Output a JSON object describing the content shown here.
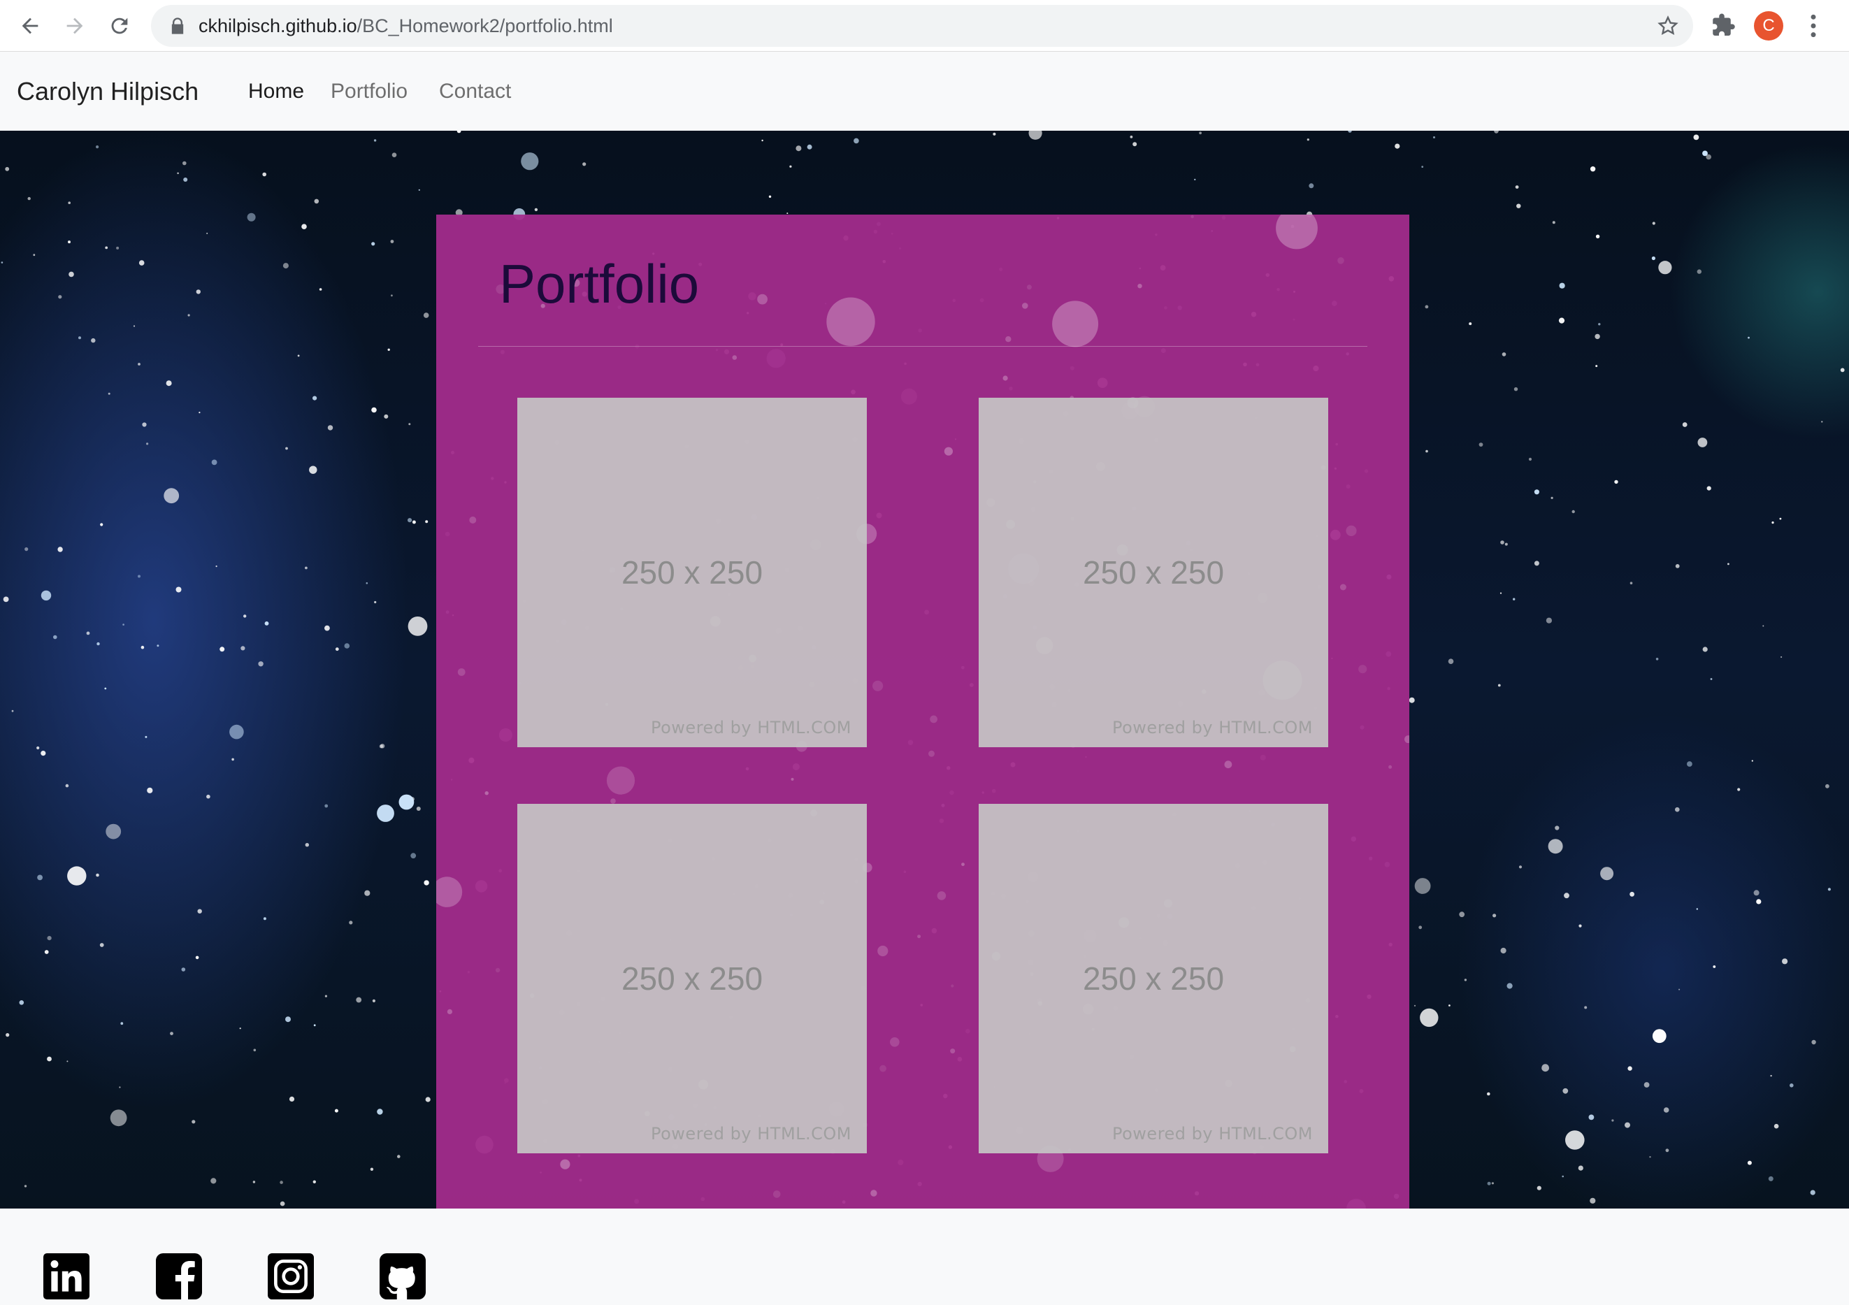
{
  "browser": {
    "url_host": "ckhilpisch.github.io",
    "url_path": "/BC_Homework2/portfolio.html",
    "profile_initial": "C",
    "icons": [
      "back-arrow-icon",
      "forward-arrow-icon",
      "reload-icon",
      "lock-icon",
      "star-icon",
      "extensions-icon",
      "menu-dots-icon"
    ]
  },
  "navbar": {
    "brand": "Carolyn Hilpisch",
    "links": [
      {
        "label": "Home",
        "active": true
      },
      {
        "label": "Portfolio",
        "active": false
      },
      {
        "label": "Contact",
        "active": false
      }
    ]
  },
  "portfolio": {
    "title": "Portfolio",
    "items": [
      {
        "size_label": "250 x 250",
        "credit": "Powered by HTML.COM"
      },
      {
        "size_label": "250 x 250",
        "credit": "Powered by HTML.COM"
      },
      {
        "size_label": "250 x 250",
        "credit": "Powered by HTML.COM"
      },
      {
        "size_label": "250 x 250",
        "credit": "Powered by HTML.COM"
      }
    ]
  },
  "footer": {
    "social_icons": [
      "linkedin-icon",
      "facebook-icon",
      "instagram-icon",
      "github-icon"
    ]
  },
  "colors": {
    "panel": "#a42c8c",
    "title": "#1c0a3a",
    "placeholder": "#c6c6c6",
    "profile": "#e8542f"
  }
}
